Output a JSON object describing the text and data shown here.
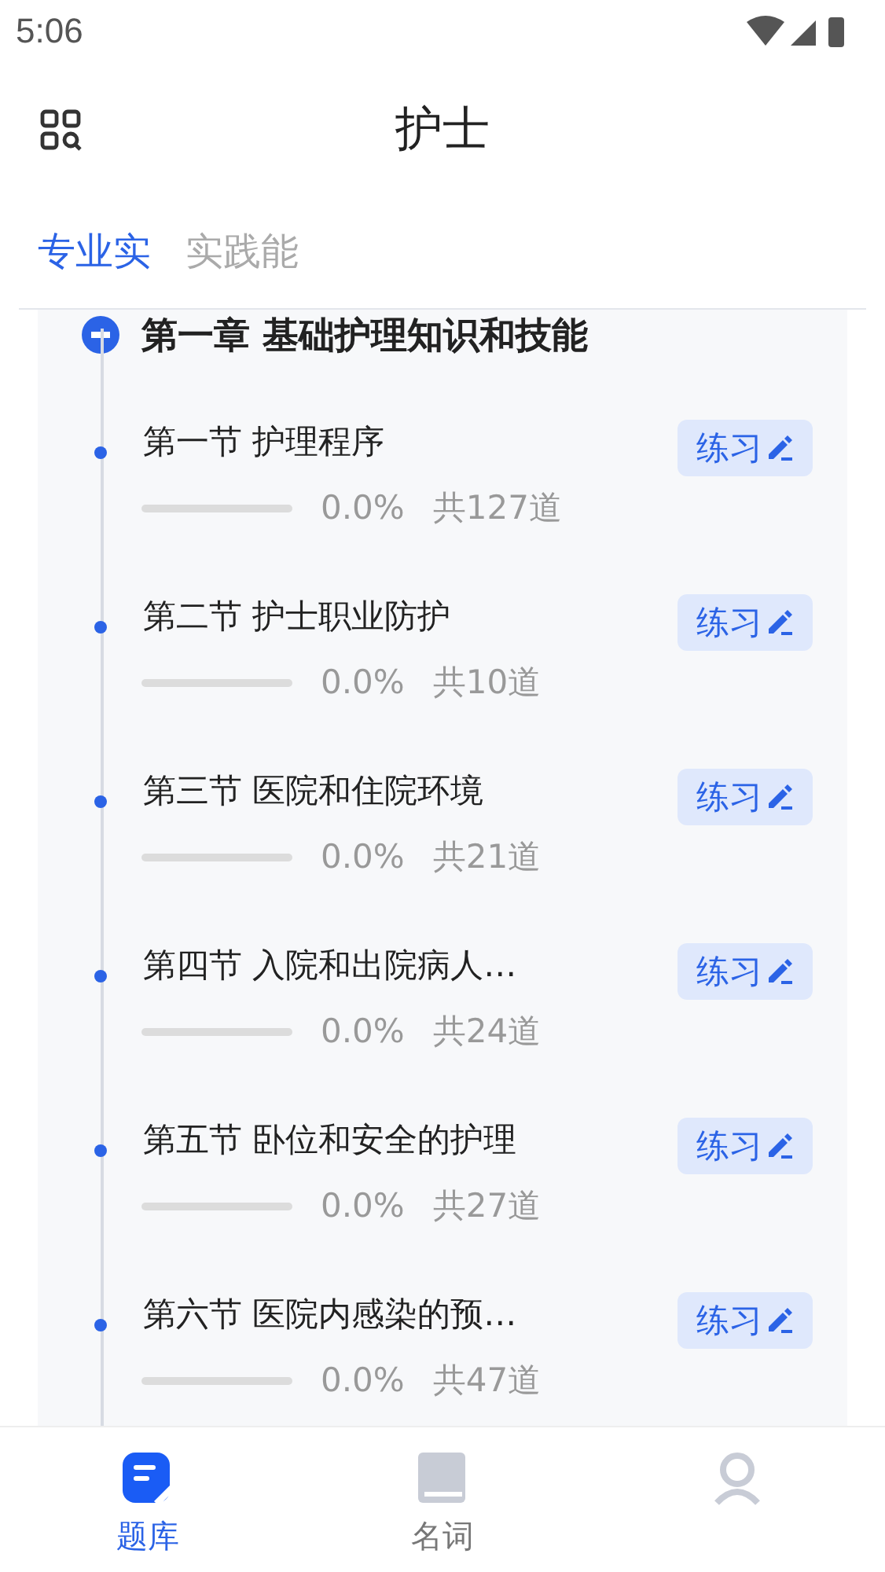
{
  "status_bar": {
    "time": "5:06"
  },
  "header": {
    "title": "护士"
  },
  "tabs": [
    {
      "label": "专业实",
      "selected": true
    },
    {
      "label": "实践能",
      "selected": false
    }
  ],
  "chapter": {
    "title": "第一章 基础护理知识和技能",
    "expanded": true
  },
  "sections": [
    {
      "title": "第一节 护理程序",
      "level": 0,
      "percent": "0.0%",
      "count": "共127道",
      "action": "练习"
    },
    {
      "title": "第二节 护士职业防护",
      "level": 0,
      "percent": "0.0%",
      "count": "共10道",
      "action": "练习"
    },
    {
      "title": "第三节 医院和住院环境",
      "level": 0,
      "percent": "0.0%",
      "count": "共21道",
      "action": "练习"
    },
    {
      "title": "第四节 入院和出院病人…",
      "level": 0,
      "percent": "0.0%",
      "count": "共24道",
      "action": "练习"
    },
    {
      "title": "第五节 卧位和安全的护理",
      "level": 0,
      "percent": "0.0%",
      "count": "共27道",
      "action": "练习"
    },
    {
      "title": "第六节 医院内感染的预…",
      "level": 0,
      "percent": "0.0%",
      "count": "共47道",
      "action": "练习"
    }
  ],
  "bottom_nav": [
    {
      "kind": "questions",
      "label": "题库",
      "selected": true
    },
    {
      "kind": "terms",
      "label": "名词",
      "selected": false
    },
    {
      "kind": "profile",
      "selected": false
    }
  ]
}
